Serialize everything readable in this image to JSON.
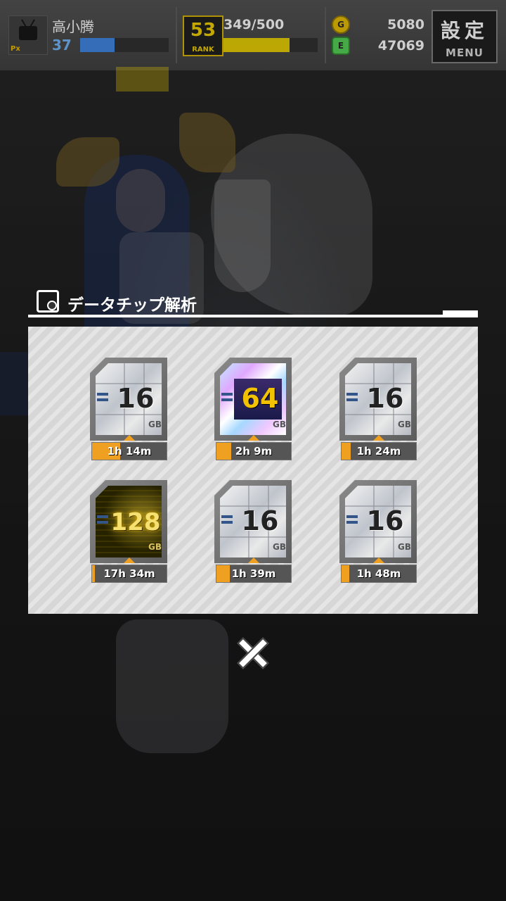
{
  "player": {
    "name": "高小腾",
    "level": "37",
    "exp_fraction": 0.39,
    "avatar_badge": "Px"
  },
  "rank": {
    "value": "53",
    "label": "RANK",
    "stamina": "349/500",
    "stamina_fraction": 0.7
  },
  "currency": {
    "gold": "5080",
    "gold_icon": "G",
    "chips": "47069",
    "chips_icon": "E"
  },
  "menu": {
    "kanji": "設定",
    "label": "MENU"
  },
  "dialog": {
    "title": "データチップ解析",
    "chips": [
      {
        "capacity": "16",
        "unit": "GB",
        "kind": "silver",
        "timer": "1h 14m",
        "progress": 0.38
      },
      {
        "capacity": "64",
        "unit": "GB",
        "kind": "rare",
        "timer": "2h 9m",
        "progress": 0.2
      },
      {
        "capacity": "16",
        "unit": "GB",
        "kind": "silver",
        "timer": "1h 24m",
        "progress": 0.12
      },
      {
        "capacity": "128",
        "unit": "GB",
        "kind": "gold",
        "timer": "17h 34m",
        "progress": 0.04
      },
      {
        "capacity": "16",
        "unit": "GB",
        "kind": "silver",
        "timer": "1h 39m",
        "progress": 0.18
      },
      {
        "capacity": "16",
        "unit": "GB",
        "kind": "silver",
        "timer": "1h 48m",
        "progress": 0.1
      }
    ]
  },
  "close_icon": "close-icon"
}
